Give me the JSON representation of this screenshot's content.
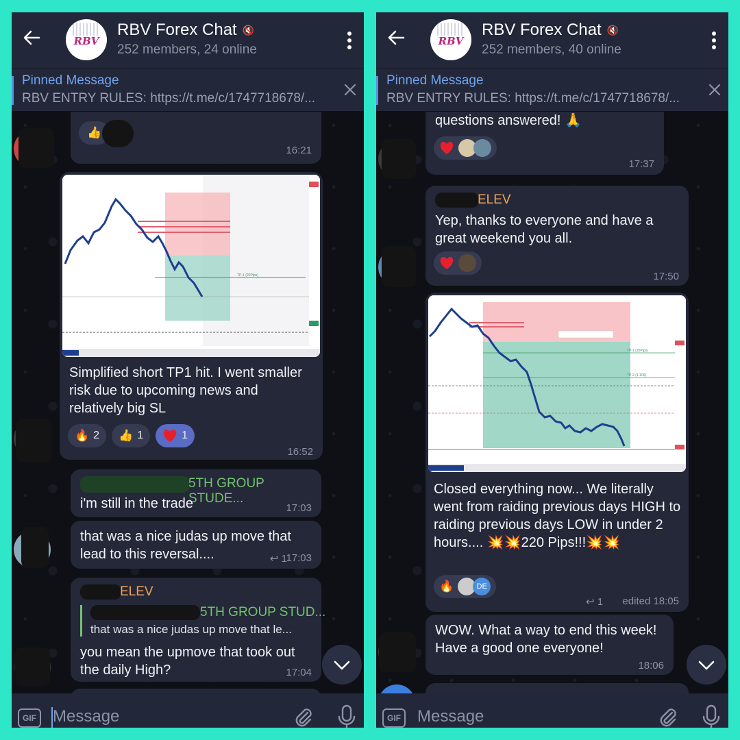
{
  "colors": {
    "frame": "#2ee6c8",
    "header": "#23273a",
    "bubble": "#242838",
    "accent": "#6fa4ef",
    "orange_name": "#f0a35c",
    "green_name": "#71c46b",
    "selected_reaction": "#5a6cc4"
  },
  "left": {
    "header": {
      "title": "RBV Forex Chat",
      "subtitle": "252 members, 24 online",
      "avatar_text": "RBV"
    },
    "pinned": {
      "title": "Pinned Message",
      "text": "RBV ENTRY RULES: https://t.me/c/1747718678/..."
    },
    "messages": [
      {
        "reactions": [
          {
            "emoji": "👍"
          }
        ],
        "time": "16:21"
      },
      {
        "text": "Simplified short TP1 hit. I went smaller risk due to upcoming news and relatively big SL",
        "reactions": [
          {
            "emoji": "🔥",
            "count": "2"
          },
          {
            "emoji": "👍",
            "count": "1"
          },
          {
            "emoji": "heart",
            "count": "1"
          }
        ],
        "time": "16:52",
        "chart_label": "TP-1 (20Pips)"
      },
      {
        "sender_suffix": "5TH GROUP STUDE...",
        "text": "i'm still in the trade",
        "time": "17:03"
      },
      {
        "text": "that was a nice judas up move that lead to this reversal....",
        "reply_count": "1",
        "time": "17:03"
      },
      {
        "sender": "ELEV",
        "quote_sender": "5TH GROUP STUD...",
        "quote_text": "that was a nice judas up move that le...",
        "text": "you mean the upmove that took out the daily High?",
        "time": "17:04"
      }
    ],
    "input_placeholder": "Message",
    "gif_label": "GIF"
  },
  "right": {
    "header": {
      "title": "RBV Forex Chat",
      "subtitle": "252 members, 40 online",
      "avatar_text": "RBV"
    },
    "pinned": {
      "title": "Pinned Message",
      "text": "RBV ENTRY RULES: https://t.me/c/1747718678/..."
    },
    "messages": [
      {
        "text": "questions answered! 🙏",
        "time": "17:37"
      },
      {
        "sender": "ELEV",
        "text": "Yep, thanks to everyone and have a great weekend you all.",
        "time": "17:50"
      },
      {
        "text": "Closed everything now... We literally went from raiding previous days HIGH to raiding previous days LOW in under 2 hours.... 💥💥220 Pips!!!💥💥",
        "reply_count": "1",
        "edited": "edited 18:05",
        "reactions": [
          {
            "emoji": "🔥"
          }
        ],
        "avatar_initials": "DE",
        "chart_label_1": "TP-1 (20Pips)",
        "chart_label_2": "TP-2 (1.100)"
      },
      {
        "text": "WOW. What a way to end this week! Have a good one everyone!",
        "time": "18:06"
      }
    ],
    "input_placeholder": "Message",
    "gif_label": "GIF"
  }
}
